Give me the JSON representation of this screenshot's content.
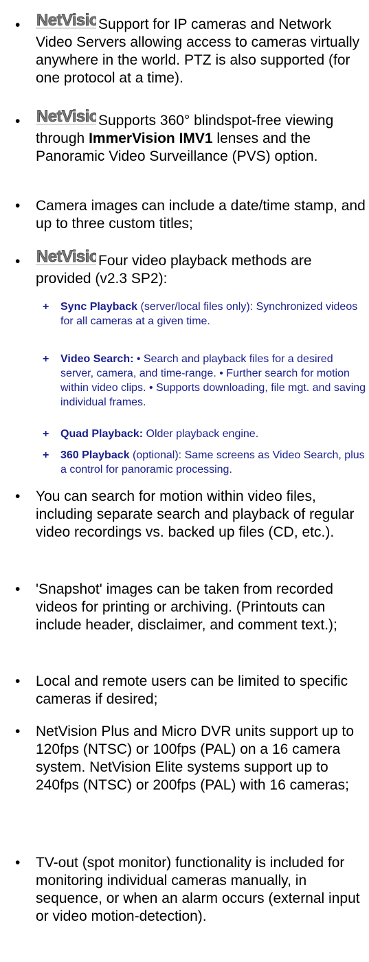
{
  "logo_text": "NetVision",
  "items": [
    {
      "text": "Support for IP cameras and Network Video Servers allowing access to cameras virtually anywhere in the world. PTZ is also supported (for one protocol at a time)."
    },
    {
      "text_a": "Supports 360° blindspot-free viewing through ",
      "bold": "ImmerVision IMV1",
      "text_b": " lenses and the Panoramic Video Surveillance (PVS) option."
    },
    {
      "text": "Camera images can include a date/time stamp, and up to three custom titles;"
    },
    {
      "text": "Four video playback methods are provided (v2.3 SP2):"
    },
    {
      "text": "You can search for motion within video files, including separate search and playback of regular video recordings vs. backed up files (CD, etc.)."
    },
    {
      "text": "'Snapshot' images can be taken from recorded videos for printing or archiving. (Printouts can include header, disclaimer, and comment text.);"
    },
    {
      "text": "Local and remote users can be limited to specific cameras if desired;"
    },
    {
      "text": "NetVision Plus and Micro DVR units support up to 120fps (NTSC) or 100fps (PAL) on a 16 camera system.  NetVision Elite systems support up to 240fps (NTSC) or 200fps (PAL) with 16 cameras;"
    },
    {
      "text": "TV-out (spot monitor) functionality is included for monitoring individual cameras manually, in sequence, or when an alarm occurs (external input or video motion-detection)."
    }
  ],
  "playback_methods": [
    {
      "bold": "Sync Playback",
      "text": " (server/local files only): Synchronized videos for all cameras at a given time."
    },
    {
      "bold": "Video Search:",
      "text": " • Search and playback files for a desired server, camera, and time-range.  • Further search for motion within video clips.  • Supports downloading, file mgt. and saving individual frames."
    },
    {
      "bold": "Quad Playback:",
      "text": "  Older playback engine."
    },
    {
      "bold": "360 Playback",
      "text": " (optional):  Same screens as Video Search, plus a control for panoramic processing."
    }
  ],
  "colors": {
    "body_text": "#000000",
    "sub_text": "#1a1f8c"
  }
}
